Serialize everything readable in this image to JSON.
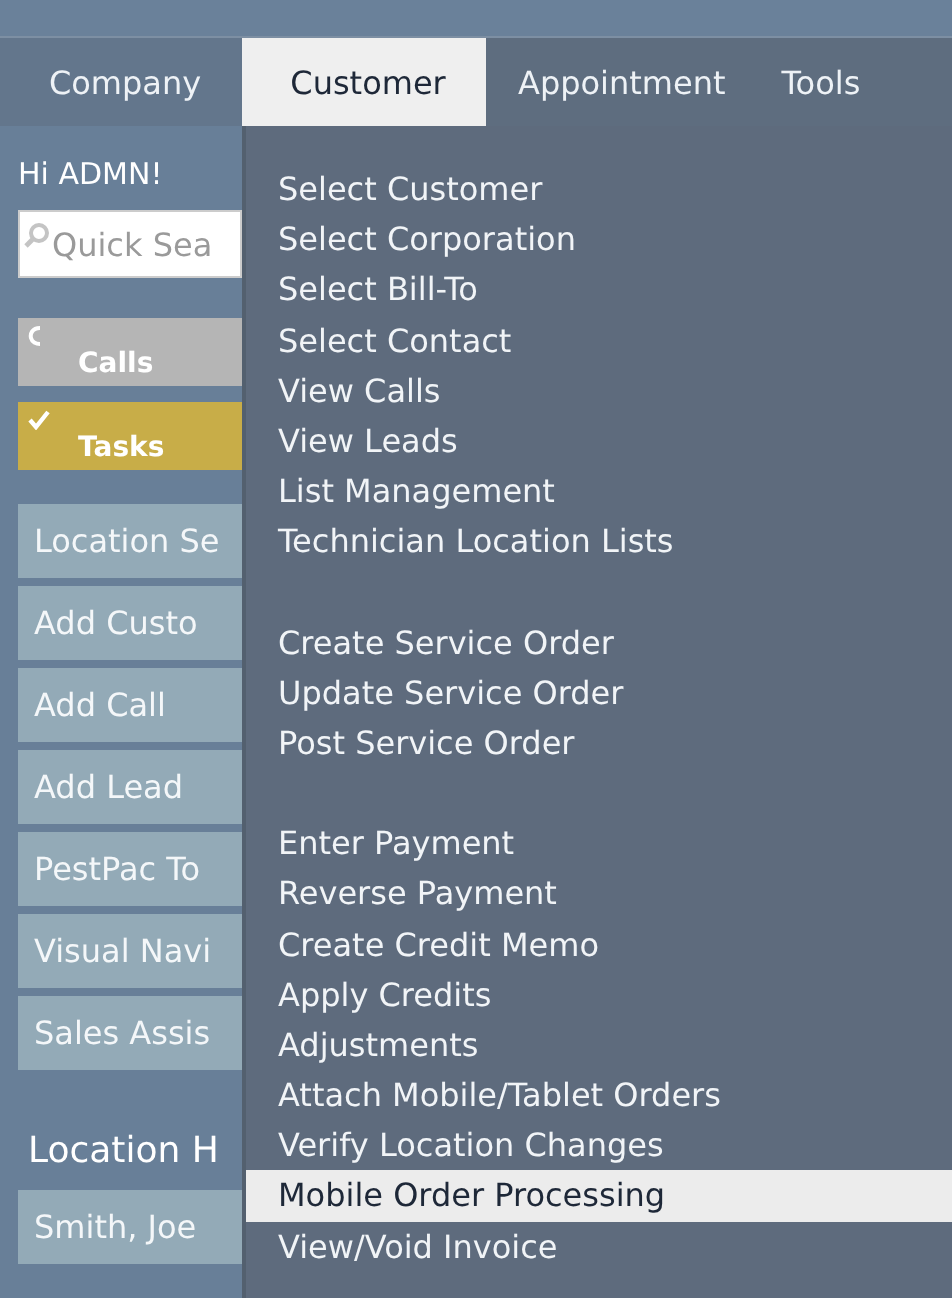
{
  "menu_bar": {
    "tabs": [
      {
        "label": "Company",
        "selected": false
      },
      {
        "label": "Customer",
        "selected": true
      },
      {
        "label": "Appointment",
        "selected": false
      },
      {
        "label": "Tools",
        "selected": false
      }
    ]
  },
  "sidebar": {
    "greeting": "Hi ADMN!",
    "search": {
      "placeholder": "Quick Sea"
    },
    "lists": [
      {
        "label": "Calls",
        "kind": "calls"
      },
      {
        "label": "Tasks",
        "kind": "tasks"
      }
    ],
    "buttons": [
      "Location Se",
      "Add Custo",
      "Add Call",
      "Add Lead",
      "PestPac To",
      "Visual Navi",
      "Sales Assis"
    ],
    "section_title": "Location H",
    "section_items": [
      "Smith, Joe"
    ]
  },
  "dropdown": {
    "groups": [
      {
        "items": [
          {
            "label": "Select Customer",
            "selected": false
          },
          {
            "label": "Select Corporation",
            "selected": false
          },
          {
            "label": "Select Bill-To",
            "selected": false
          },
          {
            "label": "Select Contact",
            "selected": false
          },
          {
            "label": "View Calls",
            "selected": false
          },
          {
            "label": "View Leads",
            "selected": false
          },
          {
            "label": "List Management",
            "selected": false
          },
          {
            "label": "Technician Location Lists",
            "selected": false
          }
        ]
      },
      {
        "items": [
          {
            "label": "Create Service Order",
            "selected": false
          },
          {
            "label": "Update Service Order",
            "selected": false
          },
          {
            "label": "Post Service Order",
            "selected": false
          }
        ]
      },
      {
        "items": [
          {
            "label": "Enter Payment",
            "selected": false
          },
          {
            "label": "Reverse Payment",
            "selected": false
          },
          {
            "label": "Create Credit Memo",
            "selected": false
          },
          {
            "label": "Apply Credits",
            "selected": false
          },
          {
            "label": "Adjustments",
            "selected": false
          },
          {
            "label": "Attach Mobile/Tablet Orders",
            "selected": false
          },
          {
            "label": "Verify Location Changes",
            "selected": false
          },
          {
            "label": "Mobile Order Processing",
            "selected": true
          },
          {
            "label": "View/Void Invoice",
            "selected": false
          }
        ]
      }
    ]
  }
}
